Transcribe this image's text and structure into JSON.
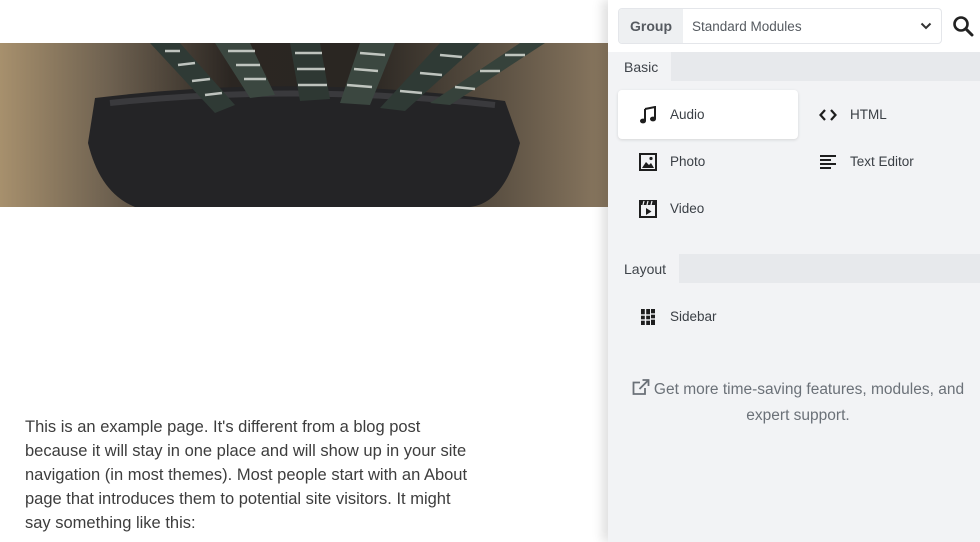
{
  "page": {
    "paragraph": "This is an example page. It's different from a blog post because it will stay in one place and will show up in your site navigation (in most themes). Most people start with an About page that introduces them to potential site visitors. It might say something like this:"
  },
  "panel": {
    "group_label": "Group",
    "group_value": "Standard Modules",
    "sections": [
      {
        "label": "Basic",
        "modules": [
          {
            "label": "Audio",
            "icon": "music-note-icon",
            "active": true
          },
          {
            "label": "HTML",
            "icon": "code-brackets-icon"
          },
          {
            "label": "Photo",
            "icon": "photo-icon"
          },
          {
            "label": "Text Editor",
            "icon": "text-lines-icon"
          },
          {
            "label": "Video",
            "icon": "video-icon"
          }
        ]
      },
      {
        "label": "Layout",
        "modules": [
          {
            "label": "Sidebar",
            "icon": "sidebar-icon"
          }
        ]
      }
    ],
    "upsell": "Get more time-saving features, modules, and expert support."
  },
  "colors": {
    "panel_bg": "#f2f3f5",
    "section_band": "#e7e9ec",
    "text": "#3a3f45",
    "muted": "#6b7178"
  }
}
